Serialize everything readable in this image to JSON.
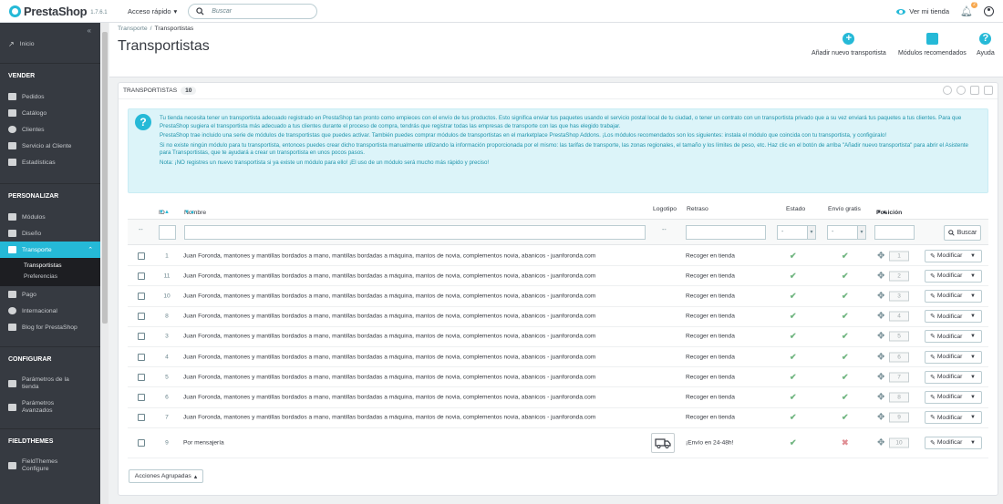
{
  "brand": {
    "name": "PrestaShop",
    "version": "1.7.6.1"
  },
  "topbar": {
    "quick_access": "Acceso rápido",
    "search_placeholder": "Buscar",
    "view_store": "Ver mi tienda",
    "notif_count": "2"
  },
  "sidebar": {
    "inicio": "Inicio",
    "sec_vender": "VENDER",
    "vender": [
      "Pedidos",
      "Catálogo",
      "Clientes",
      "Servicio al Cliente",
      "Estadísticas"
    ],
    "sec_personalizar": "PERSONALIZAR",
    "personalizar": [
      "Módulos",
      "Diseño"
    ],
    "transporte": "Transporte",
    "transporte_sub": [
      "Transportistas",
      "Preferencias"
    ],
    "personalizar2": [
      "Pago",
      "Internacional",
      "Blog for PrestaShop"
    ],
    "sec_configurar": "CONFIGURAR",
    "param_tienda_1": "Parámetros de la",
    "param_tienda_2": "tienda",
    "param_av_1": "Parámetros",
    "param_av_2": "Avanzados",
    "sec_fieldthemes": "FIELDTHEMES",
    "ft_1": "FieldThemes",
    "ft_2": "Configure"
  },
  "breadcrumb": {
    "parent": "Transporte",
    "sep": "/",
    "current": "Transportistas"
  },
  "page_title": "Transportistas",
  "toolbar": {
    "add": "Añadir nuevo transportista",
    "recommended": "Módulos recomendados",
    "help": "Ayuda"
  },
  "panel": {
    "title": "Transportistas",
    "count": "10"
  },
  "alert": {
    "p1": "Tu tienda necesita tener un transportista adecuado registrado en PrestaShop tan pronto como empieces con el envío de tus productos. Esto significa enviar tus paquetes usando el servicio postal local de tu ciudad, o tener un contrato con un transportista privado que a su vez enviará tus paquetes a tus clientes. Para que PrestaShop sugiera el transportista más adecuado a tus clientes durante el proceso de compra, tendrás que registrar todas las empresas de transporte con las que has elegido trabajar.",
    "p2": "PrestaShop trae incluido una serie de módulos de transportistas que puedes activar. También puedes comprar módulos de transportistas en el marketplace PrestaShop Addons. ¡Los módulos recomendados son los siguientes: instala el módulo que coincida con tu transportista, y configúralo!",
    "p3": "Si no existe ningún módulo para tu transportista, entonces puedes crear dicho transportista manualmente utilizando la información proporcionada por el mismo: las tarifas de transporte, las zonas regionales, el tamaño y los límites de peso, etc. Haz clic en el botón de arriba \"Añadir nuevo transportista\" para abrir el Asistente para Transportistas, que te ayudará a crear un transportista en unos pocos pasos.",
    "p4": "Nota: ¡NO registres un nuevo transportista si ya existe un módulo para ello! ¡El uso de un módulo será mucho más rápido y preciso!"
  },
  "columns": {
    "id": "ID",
    "name": "Nombre",
    "logo": "Logotipo",
    "delay": "Retraso",
    "state": "Estado",
    "free": "Envío gratis",
    "position": "Posición"
  },
  "filters": {
    "dash": "--",
    "select": "-",
    "search_btn": "Buscar"
  },
  "rows": [
    {
      "id": "1",
      "name": "Juan Foronda, mantones y mantillas bordados a mano, mantillas bordadas a máquina, mantos de novia, complementos novia, abanicos - juanforonda.com",
      "delay": "Recoger en tienda",
      "state": "✔",
      "free": "✔",
      "position": "1",
      "action": "Modificar"
    },
    {
      "id": "11",
      "name": "Juan Foronda, mantones y mantillas bordados a mano, mantillas bordadas a máquina, mantos de novia, complementos novia, abanicos - juanforonda.com",
      "delay": "Recoger en tienda",
      "state": "✔",
      "free": "✔",
      "position": "2",
      "action": "Modificar"
    },
    {
      "id": "10",
      "name": "Juan Foronda, mantones y mantillas bordados a mano, mantillas bordadas a máquina, mantos de novia, complementos novia, abanicos - juanforonda.com",
      "delay": "Recoger en tienda",
      "state": "✔",
      "free": "✔",
      "position": "3",
      "action": "Modificar"
    },
    {
      "id": "8",
      "name": "Juan Foronda, mantones y mantillas bordados a mano, mantillas bordadas a máquina, mantos de novia, complementos novia, abanicos - juanforonda.com",
      "delay": "Recoger en tienda",
      "state": "✔",
      "free": "✔",
      "position": "4",
      "action": "Modificar"
    },
    {
      "id": "3",
      "name": "Juan Foronda, mantones y mantillas bordados a mano, mantillas bordadas a máquina, mantos de novia, complementos novia, abanicos - juanforonda.com",
      "delay": "Recoger en tienda",
      "state": "✔",
      "free": "✔",
      "position": "5",
      "action": "Modificar"
    },
    {
      "id": "4",
      "name": "Juan Foronda, mantones y mantillas bordados a mano, mantillas bordadas a máquina, mantos de novia, complementos novia, abanicos - juanforonda.com",
      "delay": "Recoger en tienda",
      "state": "✔",
      "free": "✔",
      "position": "6",
      "action": "Modificar"
    },
    {
      "id": "5",
      "name": "Juan Foronda, mantones y mantillas bordados a mano, mantillas bordadas a máquina, mantos de novia, complementos novia, abanicos - juanforonda.com",
      "delay": "Recoger en tienda",
      "state": "✔",
      "free": "✔",
      "position": "7",
      "action": "Modificar"
    },
    {
      "id": "6",
      "name": "Juan Foronda, mantones y mantillas bordados a mano, mantillas bordadas a máquina, mantos de novia, complementos novia, abanicos - juanforonda.com",
      "delay": "Recoger en tienda",
      "state": "✔",
      "free": "✔",
      "position": "8",
      "action": "Modificar"
    },
    {
      "id": "7",
      "name": "Juan Foronda, mantones y mantillas bordados a mano, mantillas bordadas a máquina, mantos de novia, complementos novia, abanicos - juanforonda.com",
      "delay": "Recoger en tienda",
      "state": "✔",
      "free": "✔",
      "position": "9",
      "action": "Modificar"
    },
    {
      "id": "9",
      "name": "Por mensajería",
      "delay": "¡Envío en 24-48h!",
      "state": "✔",
      "free": "✖",
      "position": "10",
      "action": "Modificar"
    }
  ],
  "bulk_actions": "Acciones Agrupadas",
  "colors": {
    "accent": "#25b9d7",
    "sidebar_bg": "#363a41",
    "success": "#70b580",
    "danger": "#e08f95"
  }
}
